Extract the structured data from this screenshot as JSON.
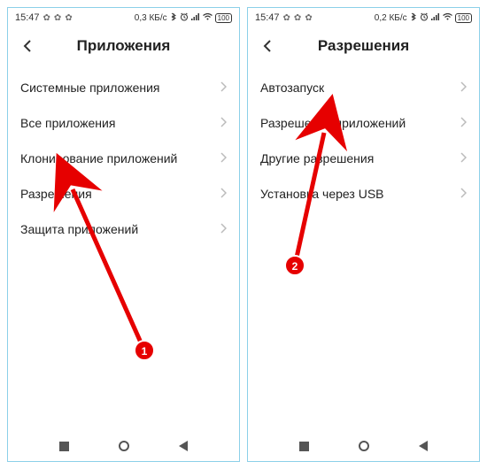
{
  "screens": [
    {
      "statusbar": {
        "time": "15:47",
        "data": "0,3 КБ/с",
        "battery": "100"
      },
      "title": "Приложения",
      "rows": [
        {
          "label": "Системные приложения"
        },
        {
          "label": "Все приложения"
        },
        {
          "label": "Клонирование приложений"
        },
        {
          "label": "Разрешения"
        },
        {
          "label": "Защита приложений"
        }
      ]
    },
    {
      "statusbar": {
        "time": "15:47",
        "data": "0,2 КБ/с",
        "battery": "100"
      },
      "title": "Разрешения",
      "rows": [
        {
          "label": "Автозапуск"
        },
        {
          "label": "Разрешения приложений"
        },
        {
          "label": "Другие разрешения"
        },
        {
          "label": "Установка через USB"
        }
      ]
    }
  ],
  "annotations": {
    "step1": "1",
    "step2": "2"
  }
}
